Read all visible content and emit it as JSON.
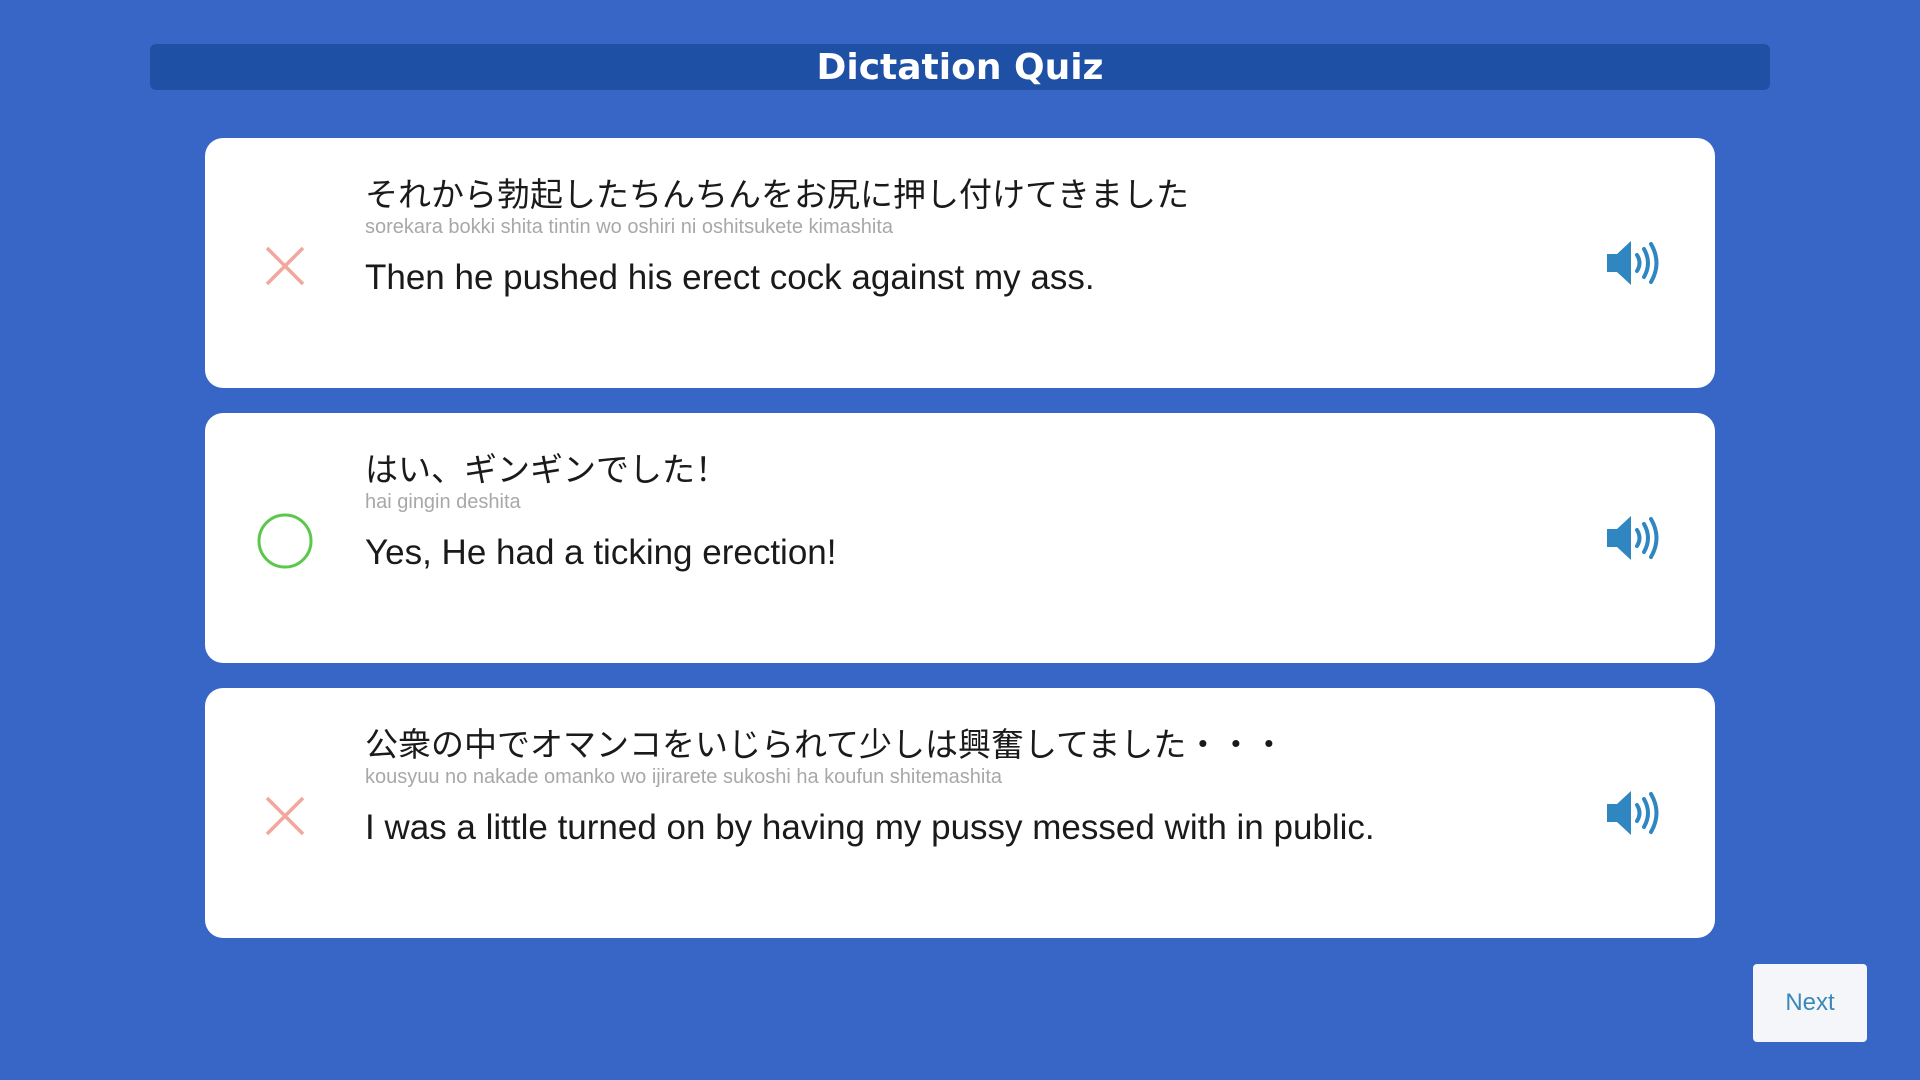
{
  "header": {
    "title": "Dictation Quiz"
  },
  "items": [
    {
      "result": "incorrect",
      "result_icon": "cross-icon",
      "japanese": "それから勃起したちんちんをお尻に押し付けてきました",
      "romaji": "sorekara bokki shita tintin wo oshiri ni oshitsukete kimashita",
      "english": "Then he pushed his erect cock against my ass.",
      "audio_icon": "speaker-icon"
    },
    {
      "result": "correct",
      "result_icon": "circle-icon",
      "japanese": "はい、ギンギンでした！",
      "romaji": "hai gingin deshita",
      "english": "Yes, He had a ticking erection!",
      "audio_icon": "speaker-icon"
    },
    {
      "result": "incorrect",
      "result_icon": "cross-icon",
      "japanese": "公衆の中でオマンコをいじられて少しは興奮してました・・・",
      "romaji": "kousyuu no nakade omanko wo ijirarete sukoshi ha koufun shitemashita",
      "english": "I was a little turned on by having my pussy messed with in public.",
      "audio_icon": "speaker-icon"
    }
  ],
  "footer": {
    "next_label": "Next"
  },
  "colors": {
    "background": "#3866c6",
    "title_bar": "#1e50a5",
    "incorrect": "#f2a79c",
    "correct": "#5bc84a",
    "speaker": "#2f86c0",
    "next_text": "#3b88b8"
  }
}
